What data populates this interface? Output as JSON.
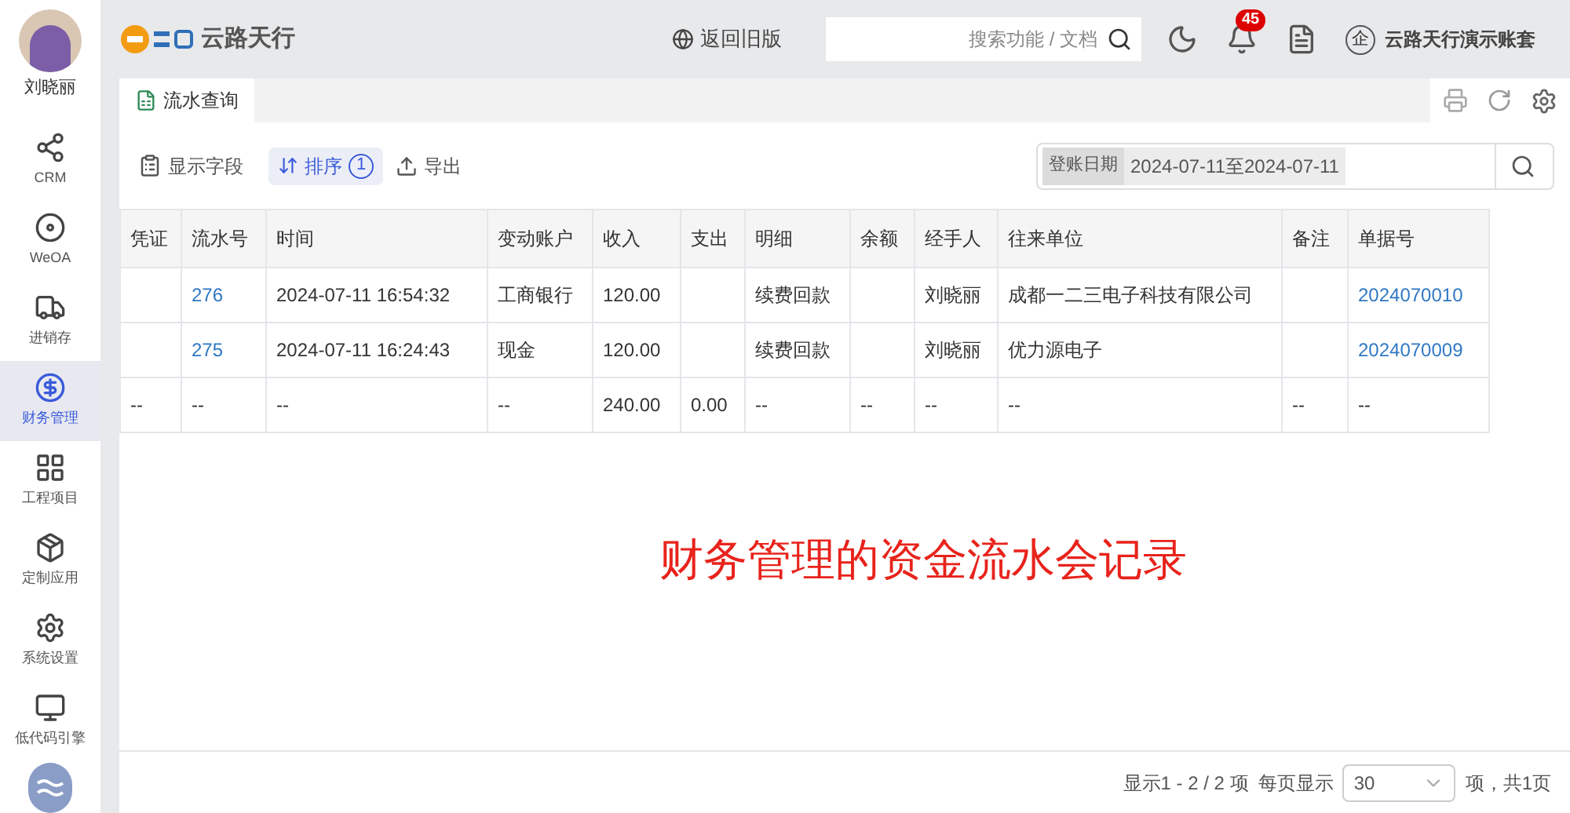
{
  "user": {
    "name": "刘晓丽"
  },
  "sidebar": {
    "items": [
      {
        "label": "CRM",
        "kind": "crm",
        "selected": false
      },
      {
        "label": "WeOA",
        "kind": "oa",
        "selected": false
      },
      {
        "label": "进销存",
        "kind": "truck",
        "selected": false
      },
      {
        "label": "财务管理",
        "kind": "finance",
        "selected": true
      },
      {
        "label": "工程项目",
        "kind": "grid",
        "selected": false
      },
      {
        "label": "定制应用",
        "kind": "box",
        "selected": false
      },
      {
        "label": "系统设置",
        "kind": "gear",
        "selected": false
      },
      {
        "label": "低代码引擎",
        "kind": "os",
        "selected": false
      }
    ]
  },
  "header": {
    "logo": "云路天行",
    "back": "返回旧版",
    "search": {
      "placeholder": "搜索功能 / 文档"
    },
    "notifications": "45",
    "account_badge": "企",
    "account": "云路天行演示账套"
  },
  "tabs": [
    {
      "label": "流水查询",
      "selected": true
    }
  ],
  "toolbar": {
    "fields": "显示字段",
    "sort": "排序",
    "sort_count": "1",
    "export": "导出",
    "filter_label": "登账日期",
    "filter_value": "2024-07-11至2024-07-11"
  },
  "table": {
    "columns": [
      "凭证",
      "流水号",
      "时间",
      "变动账户",
      "收入",
      "支出",
      "明细",
      "余额",
      "经手人",
      "往来单位",
      "备注",
      "单据号"
    ],
    "rows": [
      [
        "",
        "276",
        "2024-07-11 16:54:32",
        "工商银行",
        "120.00",
        "",
        "续费回款",
        "",
        "刘晓丽",
        "成都一二三电子科技有限公司",
        "",
        "2024070010"
      ],
      [
        "",
        "275",
        "2024-07-11 16:24:43",
        "现金",
        "120.00",
        "",
        "续费回款",
        "",
        "刘晓丽",
        "优力源电子",
        "",
        "2024070009"
      ],
      [
        "--",
        "--",
        "--",
        "--",
        "240.00",
        "0.00",
        "--",
        "--",
        "--",
        "--",
        "--",
        "--"
      ]
    ]
  },
  "annotation": "财务管理的资金流水会记录",
  "footer": {
    "range": "显示1 - 2 / 2 项",
    "per_page_label": "每页显示",
    "per_page": "30",
    "pages": "项，共1页"
  }
}
